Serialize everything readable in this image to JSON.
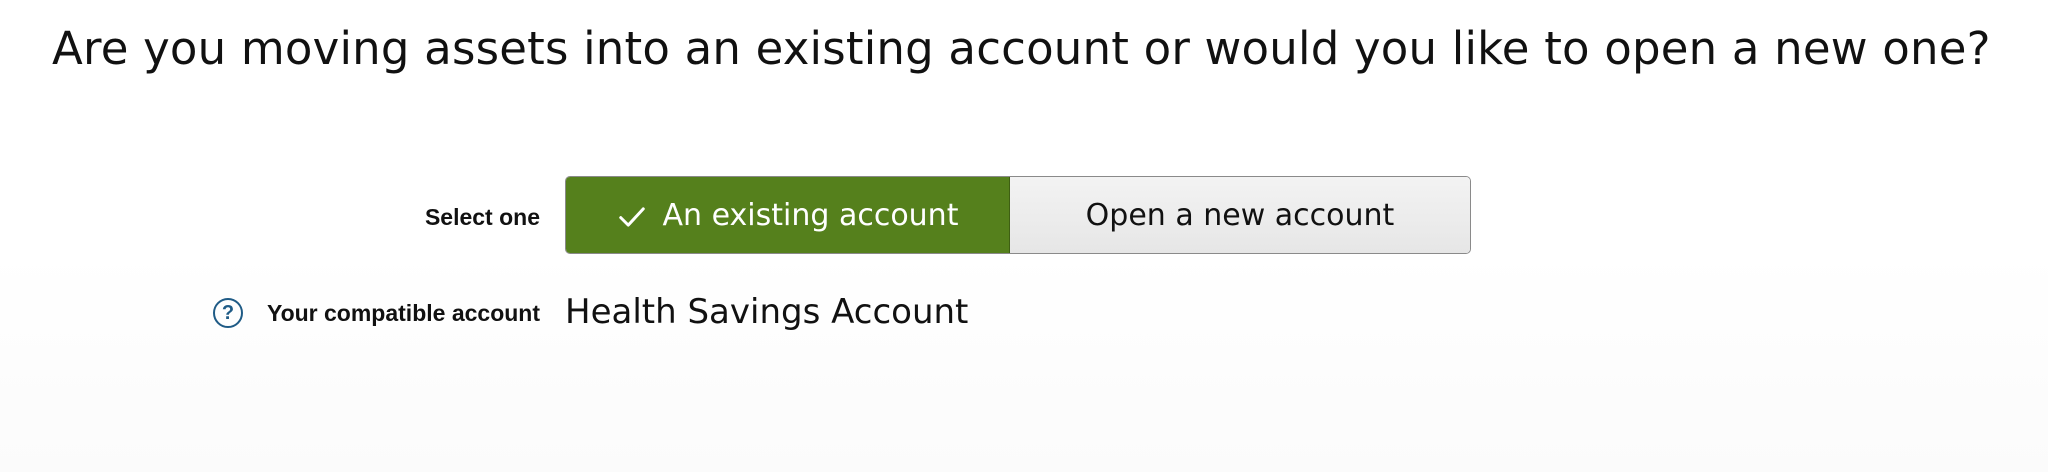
{
  "question": "Are you moving assets into an existing account or would you like to open a new one?",
  "selector": {
    "label": "Select one",
    "options": [
      {
        "label": "An existing account",
        "selected": true,
        "icon": "check-icon"
      },
      {
        "label": "Open a new account",
        "selected": false
      }
    ],
    "selected_color": "#55801c"
  },
  "compatible_account": {
    "help_icon": "question-circle-icon",
    "help_glyph": "?",
    "label": "Your compatible account",
    "value": "Health Savings Account"
  }
}
